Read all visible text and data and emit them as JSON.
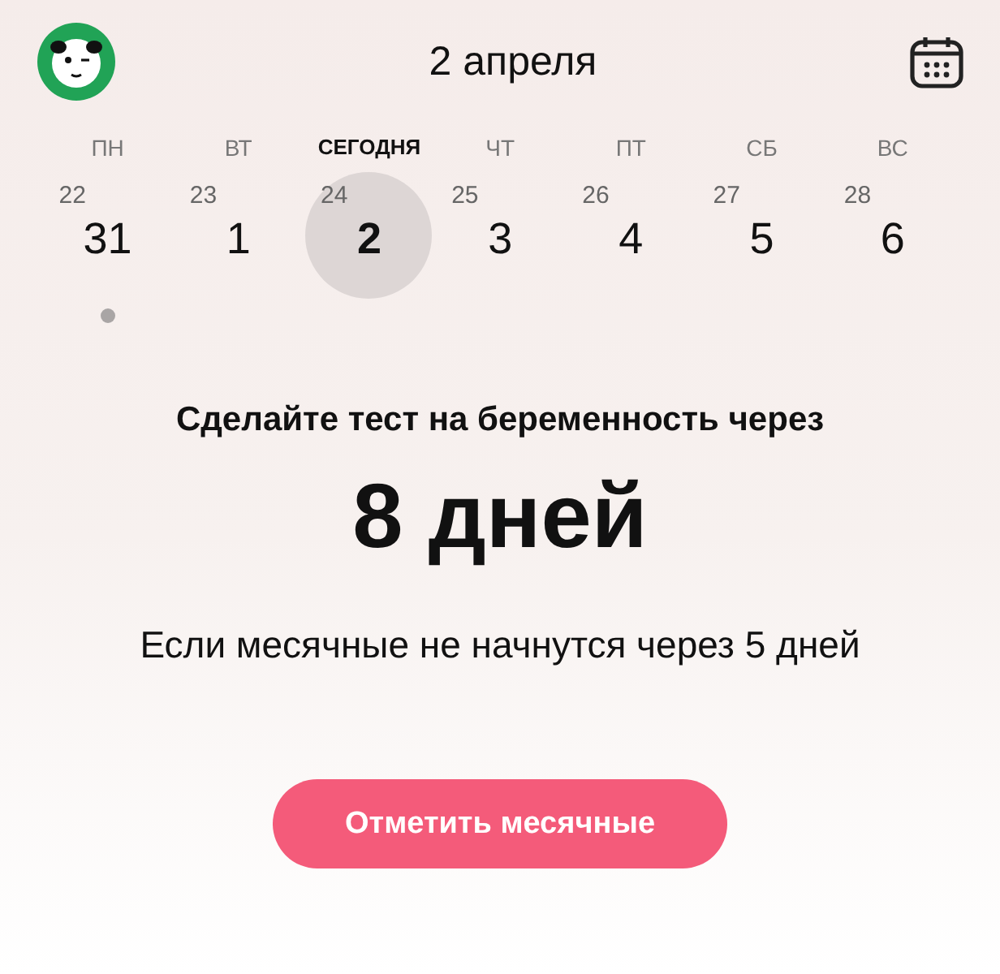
{
  "header": {
    "title": "2 апреля"
  },
  "week": [
    {
      "weekday": "ПН",
      "cycle_day": "22",
      "date": "31",
      "selected": false,
      "marked": true
    },
    {
      "weekday": "ВТ",
      "cycle_day": "23",
      "date": "1",
      "selected": false,
      "marked": false
    },
    {
      "weekday": "СЕГОДНЯ",
      "cycle_day": "24",
      "date": "2",
      "selected": true,
      "marked": false
    },
    {
      "weekday": "ЧТ",
      "cycle_day": "25",
      "date": "3",
      "selected": false,
      "marked": false
    },
    {
      "weekday": "ПТ",
      "cycle_day": "26",
      "date": "4",
      "selected": false,
      "marked": false
    },
    {
      "weekday": "СБ",
      "cycle_day": "27",
      "date": "5",
      "selected": false,
      "marked": false
    },
    {
      "weekday": "ВС",
      "cycle_day": "28",
      "date": "6",
      "selected": false,
      "marked": false
    }
  ],
  "prediction": {
    "lead": "Сделайте тест на беременность через",
    "value": "8 дней",
    "note": "Если месячные не начнутся через 5 дней"
  },
  "action_button": "Отметить месячные"
}
